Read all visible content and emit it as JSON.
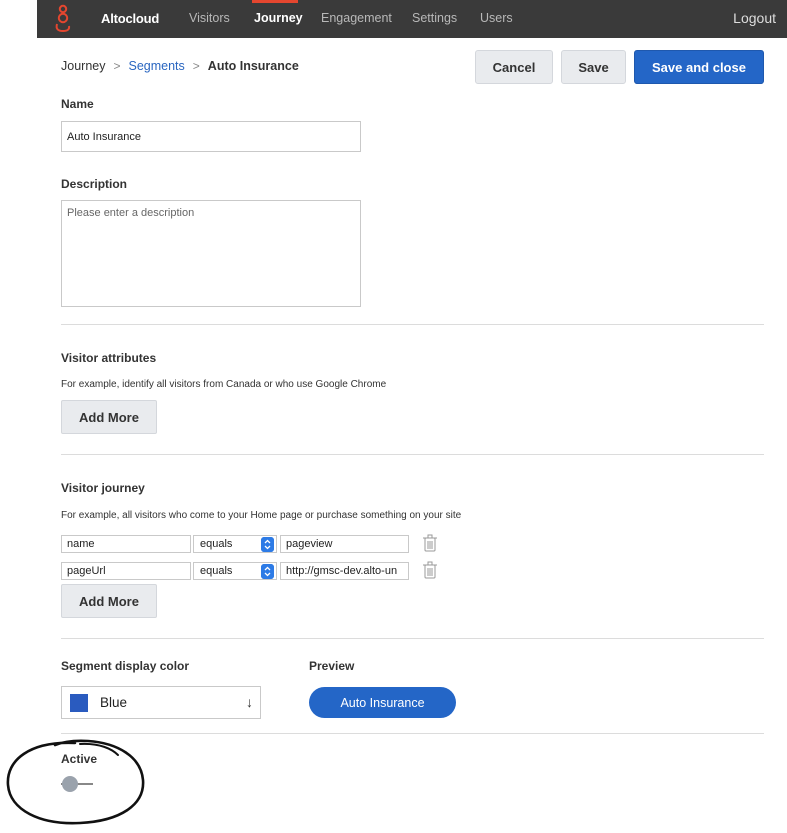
{
  "topbar": {
    "brand": "Altocloud",
    "nav": [
      "Visitors",
      "Journey",
      "Engagement",
      "Settings",
      "Users"
    ],
    "active_nav": "Journey",
    "logout": "Logout",
    "accent_color": "#e4462f"
  },
  "breadcrumb": {
    "root": "Journey",
    "parent": "Segments",
    "current": "Auto Insurance",
    "separator": ">"
  },
  "actions": {
    "cancel": "Cancel",
    "save": "Save",
    "save_close": "Save and close"
  },
  "form": {
    "name_label": "Name",
    "name_value": "Auto Insurance",
    "description_label": "Description",
    "description_placeholder": "Please enter a description"
  },
  "visitor_attributes": {
    "title": "Visitor attributes",
    "hint": "For example, identify all visitors from Canada or who use Google Chrome",
    "add_more": "Add More"
  },
  "visitor_journey": {
    "title": "Visitor journey",
    "hint": "For example, all visitors who come to your Home page or purchase something on your site",
    "rows": [
      {
        "field": "name",
        "operator": "equals",
        "value": "pageview"
      },
      {
        "field": "pageUrl",
        "operator": "equals",
        "value": "http://gmsc-dev.alto-un"
      }
    ],
    "add_more": "Add More"
  },
  "display": {
    "color_label": "Segment display color",
    "color_value": "Blue",
    "color_hex": "#2a5bbf",
    "preview_label": "Preview",
    "preview_text": "Auto Insurance"
  },
  "active": {
    "label": "Active",
    "state": "off"
  },
  "icons": {
    "logo": "altocloud-logo-icon",
    "trash": "trash-icon",
    "caret": "select-caret-icon",
    "arrow": "down-arrow-icon"
  }
}
